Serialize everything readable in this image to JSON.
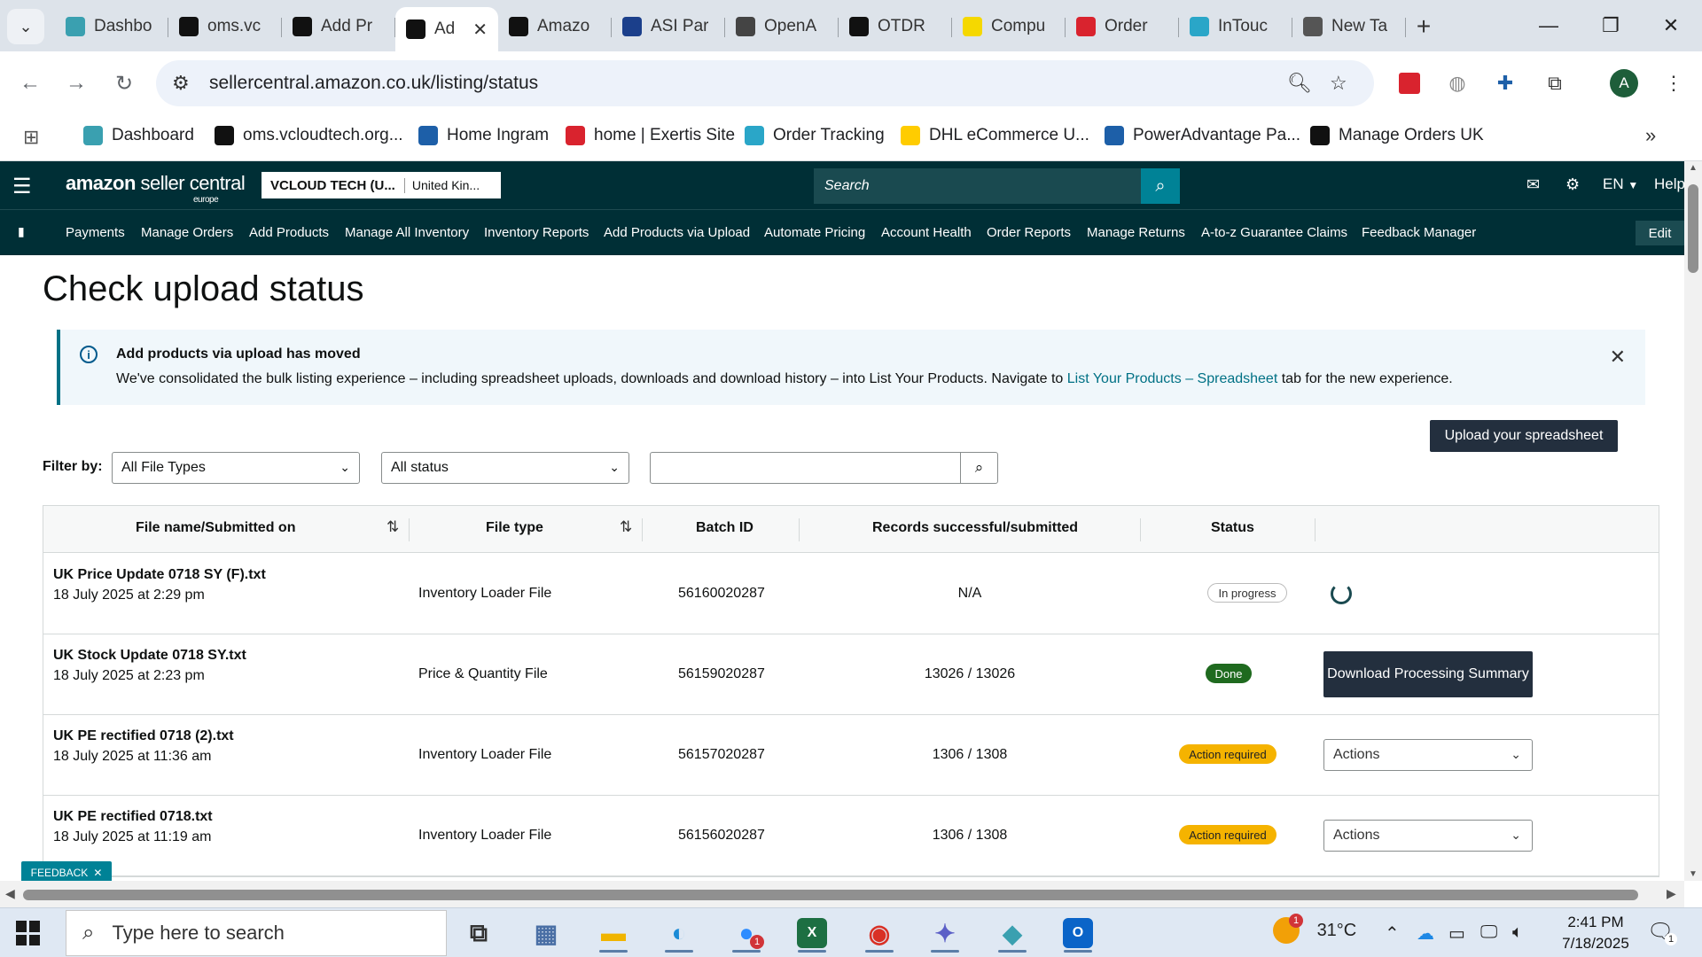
{
  "browser": {
    "tabs": [
      {
        "label": "Dashbo",
        "icon": "dashboard-icon",
        "color": "#3aa0b0"
      },
      {
        "label": "oms.vc",
        "icon": "vcloud-icon",
        "color": "#111111"
      },
      {
        "label": "Add Pr",
        "icon": "amazon-icon",
        "color": "#111111"
      },
      {
        "label": "Ad",
        "icon": "amazon-icon",
        "color": "#111111",
        "active": true
      },
      {
        "label": "Amazo",
        "icon": "amazon-icon",
        "color": "#111111"
      },
      {
        "label": "ASI Par",
        "icon": "asi-icon",
        "color": "#1b3f8b"
      },
      {
        "label": "OpenA",
        "icon": "openai-icon",
        "color": "#444444"
      },
      {
        "label": "OTDR",
        "icon": "openai-icon",
        "color": "#111111"
      },
      {
        "label": "Compu",
        "icon": "folder-icon",
        "color": "#f5d800"
      },
      {
        "label": "Order",
        "icon": "exertis-icon",
        "color": "#d9232e"
      },
      {
        "label": "InTouc",
        "icon": "intouch-icon",
        "color": "#2aa6c8"
      },
      {
        "label": "New Ta",
        "icon": "chrome-icon",
        "color": "#555555"
      }
    ],
    "url": "sellercentral.amazon.co.uk/listing/status",
    "bookmarks": [
      {
        "label": "Dashboard",
        "icon": "dashboard-icon",
        "color": "#3aa0b0"
      },
      {
        "label": "oms.vcloudtech.org...",
        "icon": "vcloud-icon",
        "color": "#111111"
      },
      {
        "label": "Home Ingram",
        "icon": "ingram-icon",
        "color": "#1d5fa8"
      },
      {
        "label": "home | Exertis Site",
        "icon": "exertis-icon",
        "color": "#d9232e"
      },
      {
        "label": "Order Tracking",
        "icon": "tracking-icon",
        "color": "#2aa6c8"
      },
      {
        "label": "DHL eCommerce U...",
        "icon": "dhl-icon",
        "color": "#ffcc00"
      },
      {
        "label": "PowerAdvantage Pa...",
        "icon": "poweradvantage-icon",
        "color": "#1d5fa8"
      },
      {
        "label": "Manage Orders UK",
        "icon": "amazon-icon",
        "color": "#111111"
      }
    ],
    "profile_initial": "A"
  },
  "seller": {
    "logo_main": "amazon",
    "logo_rest": " seller central",
    "logo_sub": "europe",
    "account_name": "VCLOUD TECH (U...",
    "account_region": "United Kin...",
    "search_placeholder": "Search",
    "lang": "EN",
    "help": "Help",
    "nav": [
      "Payments",
      "Manage Orders",
      "Add Products",
      "Manage All Inventory",
      "Inventory Reports",
      "Add Products via Upload",
      "Automate Pricing",
      "Account Health",
      "Order Reports",
      "Manage Returns",
      "A-to-z Guarantee Claims",
      "Feedback Manager"
    ],
    "edit_label": "Edit"
  },
  "page": {
    "title": "Check upload status",
    "alert_heading": "Add products via upload has moved",
    "alert_body_pre": "We've consolidated the bulk listing experience – including spreadsheet uploads, downloads and download history – into List Your Products. Navigate to ",
    "alert_link": "List Your Products – Spreadsheet",
    "alert_body_post": " tab for the new experience.",
    "upload_button": "Upload your spreadsheet",
    "filter_label": "Filter by:",
    "filter_type": "All File Types",
    "filter_status": "All status",
    "search_value": "",
    "columns": [
      "File name/Submitted on",
      "File type",
      "Batch ID",
      "Records successful/submitted",
      "Status"
    ],
    "rows": [
      {
        "name": "UK Price Update 0718 SY (F).txt",
        "date": "18 July 2025 at 2:29 pm",
        "type": "Inventory Loader File",
        "batch": "56160020287",
        "records": "N/A",
        "status": "In progress",
        "status_kind": "progress",
        "action": "spinner"
      },
      {
        "name": "UK Stock Update 0718 SY.txt",
        "date": "18 July 2025 at 2:23 pm",
        "type": "Price & Quantity File",
        "batch": "56159020287",
        "records": "13026 / 13026",
        "status": "Done",
        "status_kind": "done",
        "action": "download",
        "action_label": "Download Processing Summary"
      },
      {
        "name": "UK PE rectified 0718 (2).txt",
        "date": "18 July 2025 at 11:36 am",
        "type": "Inventory Loader File",
        "batch": "56157020287",
        "records": "1306 / 1308",
        "status": "Action required",
        "status_kind": "action",
        "action": "select",
        "action_label": "Actions"
      },
      {
        "name": "UK PE rectified 0718.txt",
        "date": "18 July 2025 at 11:19 am",
        "type": "Inventory Loader File",
        "batch": "56156020287",
        "records": "1306 / 1308",
        "status": "Action required",
        "status_kind": "action",
        "action": "select",
        "action_label": "Actions"
      }
    ],
    "feedback_label": "FEEDBACK"
  },
  "taskbar": {
    "search_placeholder": "Type here to search",
    "apps": [
      {
        "name": "task-view-icon",
        "color": "#333333"
      },
      {
        "name": "calculator-icon",
        "color": "#4a6fa5"
      },
      {
        "name": "file-explorer-icon",
        "color": "#f0b400"
      },
      {
        "name": "edge-icon",
        "color": "#1b8bd6"
      },
      {
        "name": "zoom-icon",
        "color": "#2d8cff",
        "badge": "1"
      },
      {
        "name": "excel-icon",
        "color": "#1d6f42",
        "text": "X"
      },
      {
        "name": "chrome-icon",
        "color": "#d93025"
      },
      {
        "name": "teams-icon",
        "color": "#5b5fc7"
      },
      {
        "name": "app-icon",
        "color": "#3aa0b0"
      },
      {
        "name": "outlook-icon",
        "color": "#0a64c8",
        "text": "O"
      }
    ],
    "temperature": "31°C",
    "weather_badge": "1",
    "time": "2:41 PM",
    "date": "7/18/2025",
    "notification_count": "1"
  }
}
